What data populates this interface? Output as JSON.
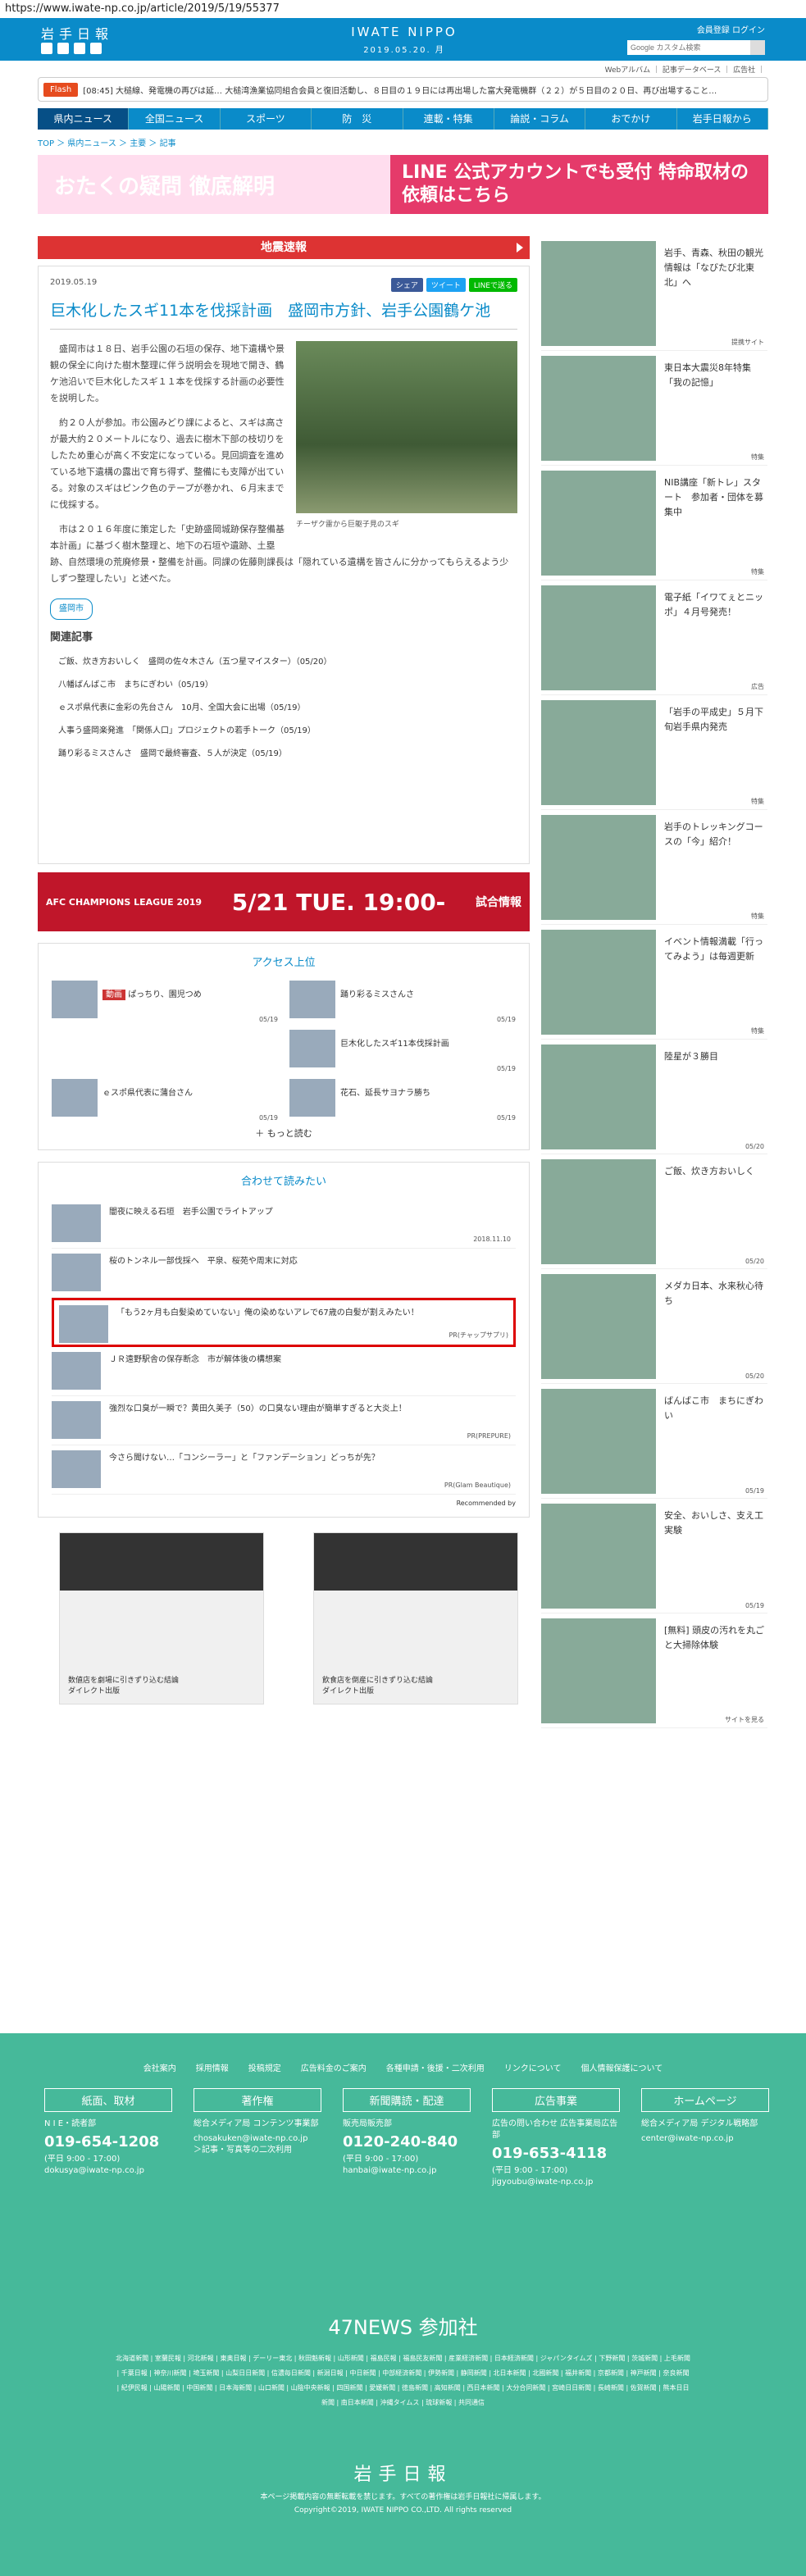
{
  "url": "https://www.iwate-np.co.jp/article/2019/5/19/55377",
  "header": {
    "logo": "岩手日報",
    "brand": "IWATE NIPPO",
    "date": "2019.05.20. 月",
    "links": "会員登録 ログイン",
    "search_placeholder": "Google カスタム検索"
  },
  "util": "Webアルバム ｜ 記事データベース ｜ 広告社 ｜",
  "flash": {
    "tag": "Flash",
    "text": "[08:45] 大槌線、発電機の再びは延… 大槌湾漁業協同組合会員と復旧活動し、８日目の１９日には再出場した富大発電機群（２２）が５日目の２０日、再び出場すること…"
  },
  "nav": [
    "県内ニュース",
    "全国ニュース",
    "スポーツ",
    "防　災",
    "連載・特集",
    "論説・コラム",
    "おでかけ",
    "岩手日報から"
  ],
  "crumb": "TOP ＞ 県内ニュース ＞ 主要 ＞ 記事",
  "banner": {
    "left": "おたくの疑問 徹底解明",
    "right": "LINE 公式アカウントでも受付 特命取材の依頼はこちら"
  },
  "breaking": "地震速報",
  "article": {
    "date": "2019.05.19",
    "share": [
      "シェア",
      "ツイート",
      "LINEで送る"
    ],
    "title": "巨木化したスギ11本を伐採計画　盛岡市方針、岩手公園鶴ケ池",
    "caption": "チーザク雷から巨躯子見のスギ",
    "p1": "盛岡市は１８日、岩手公園の石垣の保存、地下遺構や景観の保全に向けた樹木整理に伴う説明会を現地で開き、鶴ケ池沿いで巨木化したスギ１１本を伐採する計画の必要性を説明した。",
    "p2": "約２０人が参加。市公園みどり課によると、スギは高さが最大約２０メートルになり、過去に樹木下部の枝切りをしたため重心が高く不安定になっている。見回調査を進めている地下遺構の露出で育ち得ず、整備にも支障が出ている。対象のスギはピンク色のテープが巻かれ、６月末までに伐採する。",
    "p3": "市は２０１６年度に策定した「史跡盛岡城跡保存整備基本計画」に基づく樹木整理と、地下の石垣や遺跡、土塁跡、自然環境の荒廃修景・整備を計画。同課の佐藤則課長は「隠れている遺構を皆さんに分かってもらえるよう少しずつ整理したい」と述べた。",
    "place": "盛岡市",
    "related_title": "関連記事",
    "related": [
      "ご飯、炊き方おいしく　盛岡の佐々木さん（五つ星マイスター）（05/20）",
      "八幡ばんばこ市　まちにぎわい（05/19）",
      "ｅスポ県代表に金彩の先台さん　10月、全国大会に出場（05/19）",
      "人事う盛岡楽発進　「関係人口」プロジェクトの若手トーク（05/19）",
      "踊り彩るミスさんさ　盛岡で最終審査、５人が決定（05/19）"
    ]
  },
  "acl": {
    "left": "AFC CHAMPIONS LEAGUE 2019",
    "date": "5/21 TUE. 19:00-",
    "right": "試合情報"
  },
  "access": {
    "title": "アクセス上位",
    "items": [
      {
        "t": "ぱっちり、園児つめ",
        "d": "05/19",
        "badge": "動画"
      },
      {
        "t": "踊り彩るミスさんさ",
        "d": "05/19"
      },
      {
        "t": "",
        "d": ""
      },
      {
        "t": "巨木化したスギ11本伐採計画",
        "d": "05/19"
      },
      {
        "t": "ｅスポ県代表に蒲台さん",
        "d": "05/19"
      },
      {
        "t": "花石、延長サヨナラ勝ち",
        "d": "05/19"
      }
    ],
    "more": "もっと読む"
  },
  "reco": {
    "title": "合わせて読みたい",
    "items": [
      {
        "t": "闇夜に映える石垣　岩手公園でライトアップ",
        "d": "2018.11.10"
      },
      {
        "t": "桜のトンネル一部伐採へ　平泉、桜苑や周末に対応",
        "d": ""
      },
      {
        "t": "「もう2ヶ月も白髪染めていない」俺の染めないアレで67歳の白髪が割えみたい！",
        "d": "PR(チャップサプリ)"
      },
      {
        "t": "ＪＲ遠野駅舎の保存断念　市が解体後の構想案",
        "d": ""
      },
      {
        "t": "強烈な口臭が一瞬で？黄田久美子（50）の口臭ない理由が簡単すぎると大炎上！",
        "d": "PR(PREPURE)"
      },
      {
        "t": "今さら聞けない…「コンシーラー」と「ファンデーション」どっちが先？",
        "d": "PR(Glam Beautique)"
      }
    ],
    "by": "Recommended by"
  },
  "ads": [
    {
      "t": "数値店を劇場に引きずり込む結論",
      "s": "ダイレクト出版"
    },
    {
      "t": "飲食店を倒産に引きずり込む結論",
      "s": "ダイレクト出版"
    }
  ],
  "side": [
    {
      "t": "岩手、青森、秋田の観光情報は「なびたび北東北」へ",
      "c": "提携サイト"
    },
    {
      "t": "東日本大震災8年特集「我の記憶」",
      "c": "特集"
    },
    {
      "t": "NIB講座「新トレ」スタート　参加者・団体を募集中",
      "c": "特集"
    },
    {
      "t": "電子紙「イワてぇとニッポ」４月号発売！",
      "c": "広告"
    },
    {
      "t": "「岩手の平成史」５月下旬岩手県内発売",
      "c": "特集"
    },
    {
      "t": "岩手のトレッキングコースの「今」紹介！",
      "c": "特集"
    },
    {
      "t": "イベント情報満載「行ってみよう」は毎週更新",
      "c": "特集"
    },
    {
      "t": "陸星が３勝目",
      "c": "05/20"
    },
    {
      "t": "ご飯、炊き方おいしく",
      "c": "05/20"
    },
    {
      "t": "メダカ日本、水来秋心待ち",
      "c": "05/20"
    },
    {
      "t": "ばんばこ市　まちにぎわい",
      "c": "05/19"
    },
    {
      "t": "安全、おいしさ、支え工実験",
      "c": "05/19"
    },
    {
      "t": "[無料] 頭皮の汚れを丸ごと大掃除体験",
      "c": "サイトを見る"
    }
  ],
  "footer": {
    "links": [
      "会社案内",
      "採用情報",
      "投稿規定",
      "広告料金のご案内",
      "各種申請・後援・二次利用",
      "リンクについて",
      "個人情報保護について"
    ],
    "cols": [
      {
        "h": "紙面、取材",
        "a": "N I E・読者部",
        "tel": "019-654-1208",
        "b": "(平日 9:00 - 17:00)",
        "mail": "dokusya@iwate-np.co.jp"
      },
      {
        "h": "著作権",
        "a": "総合メディア局 コンテンツ事業部",
        "tel": "",
        "b": "chosakuken@iwate-np.co.jp",
        "mail": "＞記事・写真等の二次利用"
      },
      {
        "h": "新聞購読・配達",
        "a": "販売局販売部",
        "tel": "0120-240-840",
        "b": "(平日 9:00 - 17:00)",
        "mail": "hanbai@iwate-np.co.jp"
      },
      {
        "h": "広告事業",
        "a": "広告の問い合わせ 広告事業局広告部",
        "tel": "019-653-4118",
        "b": "(平日 9:00 - 17:00)",
        "mail": "jigyoubu@iwate-np.co.jp"
      },
      {
        "h": "ホームページ",
        "a": "総合メディア局 デジタル戦略部",
        "tel": "",
        "b": "center@iwate-np.co.jp",
        "mail": ""
      }
    ],
    "news47": "47NEWS 参加社",
    "sites": "北海道新聞 | 室蘭民報 | 河北新報 | 東奥日報 | デーリー東北 | 秋田魁新報 | 山形新聞 | 福島民報 | 福島民友新聞 | 産業経済新聞 | 日本経済新聞 | ジャパンタイムズ | 下野新聞 | 茨城新聞 | 上毛新聞 | 千葉日報 | 神奈川新聞 | 埼玉新聞 | 山梨日日新聞 | 信濃毎日新聞 | 新潟日報 | 中日新聞 | 中部経済新聞 | 伊勢新聞 | 静岡新聞 | 北日本新聞 | 北國新聞 | 福井新聞 | 京都新聞 | 神戸新聞 | 奈良新聞 | 紀伊民報 | 山陽新聞 | 中国新聞 | 日本海新聞 | 山口新聞 | 山陰中央新報 | 四国新聞 | 愛媛新聞 | 徳島新聞 | 高知新聞 | 西日本新聞 | 大分合同新聞 | 宮崎日日新聞 | 長崎新聞 | 佐賀新聞 | 熊本日日新聞 | 南日本新聞 | 沖縄タイムス | 琉球新報 | 共同通信",
    "logo": "岩手日報",
    "note": "本ページ掲載内容の無断転載を禁じます。すべての著作権は岩手日報社に帰属します。",
    "copy": "Copyright©2019, IWATE NIPPO CO.,LTD. All rights reserved"
  }
}
